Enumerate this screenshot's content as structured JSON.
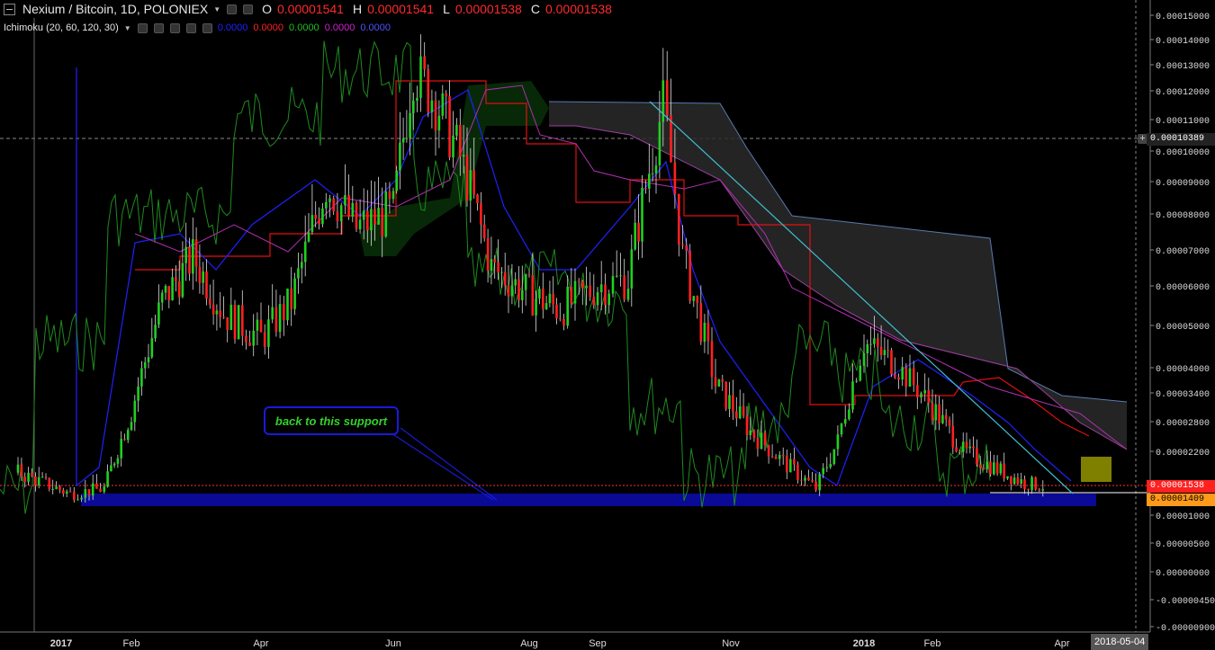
{
  "header": {
    "symbol": "Nexium / Bitcoin, 1D, POLONIEX",
    "open_label": "O",
    "open": "0.00001541",
    "high_label": "H",
    "high": "0.00001541",
    "low_label": "L",
    "low": "0.00001538",
    "close_label": "C",
    "close": "0.00001538"
  },
  "indicator": {
    "name": "Ichimoku (20, 60, 120, 30)",
    "values": [
      {
        "value": "0.0000",
        "color": "#2020ff"
      },
      {
        "value": "0.0000",
        "color": "#ff2020"
      },
      {
        "value": "0.0000",
        "color": "#20c020"
      },
      {
        "value": "0.0000",
        "color": "#d020d0"
      },
      {
        "value": "0.0000",
        "color": "#5050ff"
      }
    ]
  },
  "annotation": {
    "text": "back to this support"
  },
  "price_tags": {
    "crosshair": "0.00010389",
    "last": "0.00001538",
    "support": "0.00001409"
  },
  "date_tag": "2018-05-04",
  "colors": {
    "up": "#20d020",
    "down": "#ff2020",
    "tenkan": "#2020ff",
    "kijun": "#e01010",
    "chikou": "#1f8a1f",
    "span_a": "#a040a0",
    "span_b": "#5a7ab0",
    "trendline": "#40c0d0",
    "support_band": "#0a0a96",
    "target_box": "#808000"
  },
  "chart_data": {
    "type": "candlestick",
    "title": "Nexium / Bitcoin, 1D, POLONIEX",
    "indicator": "Ichimoku (20, 60, 120, 30)",
    "y_ticks": [
      "0.00015000",
      "0.00014000",
      "0.00013000",
      "0.00012000",
      "0.00011000",
      "0.00010000",
      "0.00009000",
      "0.00008000",
      "0.00007000",
      "0.00006000",
      "0.00005000",
      "0.00004000",
      "0.00003400",
      "0.00002800",
      "0.00002200",
      "0.00001000",
      "0.00000500",
      "0.00000000",
      "-0.00000450",
      "-0.00000900"
    ],
    "x_ticks": [
      "2017",
      "Feb",
      "Apr",
      "Jun",
      "Aug",
      "Sep",
      "Nov",
      "2018",
      "Feb",
      "Apr"
    ],
    "close_series": [
      {
        "date": "2016-12-20",
        "close": 1.8e-05
      },
      {
        "date": "2017-01-05",
        "close": 1.4e-05
      },
      {
        "date": "2017-01-20",
        "close": 1.5e-05
      },
      {
        "date": "2017-02-01",
        "close": 3e-05
      },
      {
        "date": "2017-02-15",
        "close": 5.6e-05
      },
      {
        "date": "2017-03-01",
        "close": 6.8e-05
      },
      {
        "date": "2017-03-15",
        "close": 5.3e-05
      },
      {
        "date": "2017-04-01",
        "close": 4.7e-05
      },
      {
        "date": "2017-04-15",
        "close": 5.6e-05
      },
      {
        "date": "2017-05-01",
        "close": 8.9e-05
      },
      {
        "date": "2017-05-15",
        "close": 7.6e-05
      },
      {
        "date": "2017-06-01",
        "close": 8.1e-05
      },
      {
        "date": "2017-06-10",
        "close": 0.000128
      },
      {
        "date": "2017-06-20",
        "close": 0.000117
      },
      {
        "date": "2017-07-01",
        "close": 9.8e-05
      },
      {
        "date": "2017-07-15",
        "close": 6.5e-05
      },
      {
        "date": "2017-08-01",
        "close": 5.8e-05
      },
      {
        "date": "2017-08-15",
        "close": 5.4e-05
      },
      {
        "date": "2017-09-01",
        "close": 6e-05
      },
      {
        "date": "2017-09-15",
        "close": 6.2e-05
      },
      {
        "date": "2017-10-01",
        "close": 0.000115
      },
      {
        "date": "2017-10-10",
        "close": 6.8e-05
      },
      {
        "date": "2017-10-25",
        "close": 3.6e-05
      },
      {
        "date": "2017-11-10",
        "close": 2.6e-05
      },
      {
        "date": "2017-11-25",
        "close": 2e-05
      },
      {
        "date": "2017-12-10",
        "close": 1.5e-05
      },
      {
        "date": "2017-12-20",
        "close": 2.4e-05
      },
      {
        "date": "2018-01-01",
        "close": 4.6e-05
      },
      {
        "date": "2018-01-15",
        "close": 4.1e-05
      },
      {
        "date": "2018-02-01",
        "close": 3.1e-05
      },
      {
        "date": "2018-02-15",
        "close": 2.2e-05
      },
      {
        "date": "2018-03-01",
        "close": 1.9e-05
      },
      {
        "date": "2018-03-15",
        "close": 1.6e-05
      },
      {
        "date": "2018-03-25",
        "close": 1.54e-05
      }
    ],
    "support_level": 1.409e-05,
    "last_price": 1.538e-05,
    "annotation": "back to this support"
  }
}
